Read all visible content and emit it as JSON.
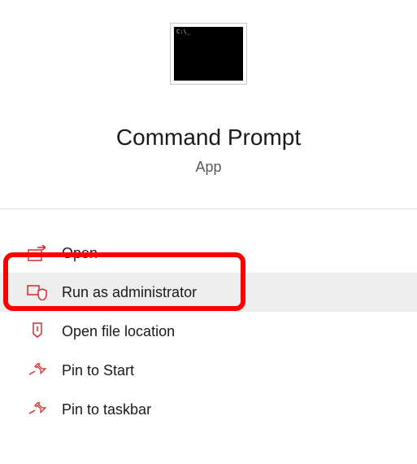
{
  "header": {
    "title": "Command Prompt",
    "subtitle": "App",
    "icon_prompt": "C:\\_"
  },
  "actions": {
    "open": {
      "label": "Open"
    },
    "run_admin": {
      "label": "Run as administrator"
    },
    "open_location": {
      "label": "Open file location"
    },
    "pin_start": {
      "label": "Pin to Start"
    },
    "pin_taskbar": {
      "label": "Pin to taskbar"
    }
  },
  "colors": {
    "accent": "#d42a2a"
  }
}
